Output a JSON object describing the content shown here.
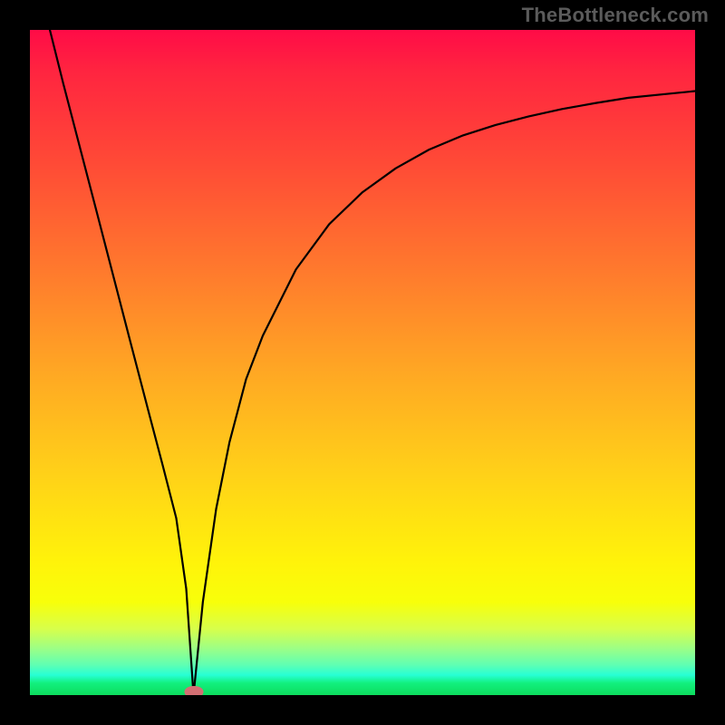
{
  "watermark": "TheBottleneck.com",
  "chart_data": {
    "type": "line",
    "title": "",
    "xlabel": "",
    "ylabel": "",
    "xlim": [
      0,
      100
    ],
    "ylim": [
      0,
      100
    ],
    "series": [
      {
        "name": "curve",
        "x": [
          3,
          5,
          10,
          15,
          18,
          20,
          22,
          23.5,
          24.6,
          26,
          28,
          30,
          32.5,
          35,
          40,
          45,
          50,
          55,
          60,
          65,
          70,
          75,
          80,
          85,
          90,
          95,
          100
        ],
        "y": [
          100,
          92,
          72.8,
          53.5,
          42,
          34.4,
          26.6,
          16,
          0,
          14,
          28,
          38,
          47.5,
          54,
          64,
          70.8,
          75.6,
          79.2,
          82,
          84.1,
          85.7,
          87.0,
          88.1,
          89.0,
          89.8,
          90.3,
          90.8
        ]
      }
    ],
    "annotations": [
      {
        "name": "min-marker",
        "x": 24.6,
        "y": 0
      }
    ],
    "background_gradient": {
      "top": "#ff0b47",
      "mid": "#ffcf19",
      "bottom": "#0ddc5d"
    }
  }
}
